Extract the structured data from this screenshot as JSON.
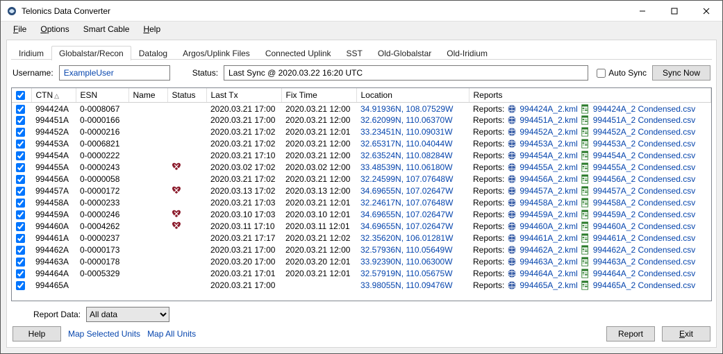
{
  "window": {
    "title": "Telonics Data Converter"
  },
  "menu": {
    "file": "File",
    "options": "Options",
    "smartcable": "Smart Cable",
    "help": "Help"
  },
  "tabs": [
    {
      "label": "Iridium"
    },
    {
      "label": "Globalstar/Recon"
    },
    {
      "label": "Datalog"
    },
    {
      "label": "Argos/Uplink Files"
    },
    {
      "label": "Connected Uplink"
    },
    {
      "label": "SST"
    },
    {
      "label": "Old-Globalstar"
    },
    {
      "label": "Old-Iridium"
    }
  ],
  "toprow": {
    "username_label": "Username:",
    "username_value": "ExampleUser",
    "status_label": "Status:",
    "status_value": "Last Sync @ 2020.03.22 16:20 UTC",
    "autosync_label": "Auto Sync",
    "syncnow_label": "Sync Now"
  },
  "columns": {
    "ctn": "CTN",
    "esn": "ESN",
    "name": "Name",
    "status": "Status",
    "lasttx": "Last Tx",
    "fixtime": "Fix Time",
    "location": "Location",
    "reports": "Reports"
  },
  "rows": [
    {
      "ctn": "994424A",
      "esn": "0-0008067",
      "status": "",
      "lasttx": "2020.03.21 17:00",
      "fix": "2020.03.21 12:00",
      "loc": "34.91936N, 108.07529W",
      "kml": "994424A_2.kml",
      "csv": "994424A_2 Condensed.csv"
    },
    {
      "ctn": "994451A",
      "esn": "0-0000166",
      "status": "",
      "lasttx": "2020.03.21 17:00",
      "fix": "2020.03.21 12:00",
      "loc": "32.62099N, 110.06370W",
      "kml": "994451A_2.kml",
      "csv": "994451A_2 Condensed.csv"
    },
    {
      "ctn": "994452A",
      "esn": "0-0000216",
      "status": "",
      "lasttx": "2020.03.21 17:02",
      "fix": "2020.03.21 12:01",
      "loc": "33.23451N, 110.09031W",
      "kml": "994452A_2.kml",
      "csv": "994452A_2 Condensed.csv"
    },
    {
      "ctn": "994453A",
      "esn": "0-0006821",
      "status": "",
      "lasttx": "2020.03.21 17:02",
      "fix": "2020.03.21 12:00",
      "loc": "32.65317N, 110.04044W",
      "kml": "994453A_2.kml",
      "csv": "994453A_2 Condensed.csv"
    },
    {
      "ctn": "994454A",
      "esn": "0-0000222",
      "status": "",
      "lasttx": "2020.03.21 17:10",
      "fix": "2020.03.21 12:00",
      "loc": "32.63524N, 110.08284W",
      "kml": "994454A_2.kml",
      "csv": "994454A_2 Condensed.csv"
    },
    {
      "ctn": "994455A",
      "esn": "0-0000243",
      "status": "heart",
      "lasttx": "2020.03.02 17:02",
      "fix": "2020.03.02 12:00",
      "loc": "33.48539N, 110.06180W",
      "kml": "994455A_2.kml",
      "csv": "994455A_2 Condensed.csv"
    },
    {
      "ctn": "994456A",
      "esn": "0-0000058",
      "status": "",
      "lasttx": "2020.03.21 17:02",
      "fix": "2020.03.21 12:00",
      "loc": "32.24599N, 107.07648W",
      "kml": "994456A_2.kml",
      "csv": "994456A_2 Condensed.csv"
    },
    {
      "ctn": "994457A",
      "esn": "0-0000172",
      "status": "heart",
      "lasttx": "2020.03.13 17:02",
      "fix": "2020.03.13 12:00",
      "loc": "34.69655N, 107.02647W",
      "kml": "994457A_2.kml",
      "csv": "994457A_2 Condensed.csv"
    },
    {
      "ctn": "994458A",
      "esn": "0-0000233",
      "status": "",
      "lasttx": "2020.03.21 17:03",
      "fix": "2020.03.21 12:01",
      "loc": "32.24617N, 107.07648W",
      "kml": "994458A_2.kml",
      "csv": "994458A_2 Condensed.csv"
    },
    {
      "ctn": "994459A",
      "esn": "0-0000246",
      "status": "heart",
      "lasttx": "2020.03.10 17:03",
      "fix": "2020.03.10 12:01",
      "loc": "34.69655N, 107.02647W",
      "kml": "994459A_2.kml",
      "csv": "994459A_2 Condensed.csv"
    },
    {
      "ctn": "994460A",
      "esn": "0-0004262",
      "status": "heart",
      "lasttx": "2020.03.11 17:10",
      "fix": "2020.03.11 12:01",
      "loc": "34.69655N, 107.02647W",
      "kml": "994460A_2.kml",
      "csv": "994460A_2 Condensed.csv"
    },
    {
      "ctn": "994461A",
      "esn": "0-0000237",
      "status": "",
      "lasttx": "2020.03.21 17:17",
      "fix": "2020.03.21 12:02",
      "loc": "32.35620N, 106.01281W",
      "kml": "994461A_2.kml",
      "csv": "994461A_2 Condensed.csv"
    },
    {
      "ctn": "994462A",
      "esn": "0-0000173",
      "status": "",
      "lasttx": "2020.03.21 17:00",
      "fix": "2020.03.21 12:00",
      "loc": "32.57936N, 110.05649W",
      "kml": "994462A_2.kml",
      "csv": "994462A_2 Condensed.csv"
    },
    {
      "ctn": "994463A",
      "esn": "0-0000178",
      "status": "",
      "lasttx": "2020.03.20 17:00",
      "fix": "2020.03.20 12:01",
      "loc": "33.92390N, 110.06300W",
      "kml": "994463A_2.kml",
      "csv": "994463A_2 Condensed.csv"
    },
    {
      "ctn": "994464A",
      "esn": "0-0005329",
      "status": "",
      "lasttx": "2020.03.21 17:01",
      "fix": "2020.03.21 12:01",
      "loc": "32.57919N, 110.05675W",
      "kml": "994464A_2.kml",
      "csv": "994464A_2 Condensed.csv"
    },
    {
      "ctn": "994465A",
      "esn": "",
      "status": "",
      "lasttx": "2020.03.21 17:00",
      "fix": "",
      "loc": "33.98055N, 110.09476W",
      "kml": "994465A_2.kml",
      "csv": "994465A_2 Condensed.csv"
    }
  ],
  "reports_label": "Reports:",
  "bottom": {
    "reportdata_label": "Report Data:",
    "reportdata_value": "All data"
  },
  "footer": {
    "help": "Help",
    "map_selected": "Map Selected Units",
    "map_all": "Map All Units",
    "report": "Report",
    "exit": "Exit"
  }
}
